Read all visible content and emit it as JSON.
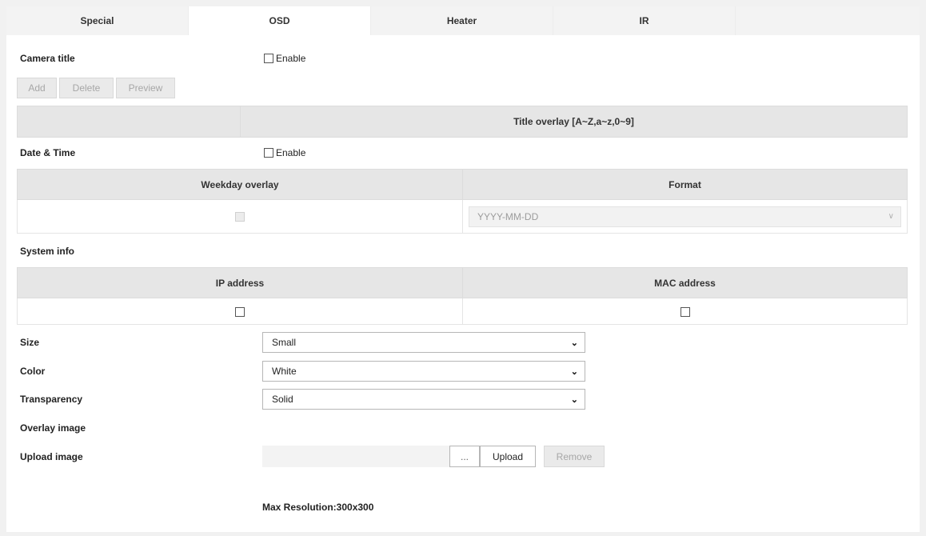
{
  "tabs": [
    {
      "label": "Special",
      "active": false
    },
    {
      "label": "OSD",
      "active": true
    },
    {
      "label": "Heater",
      "active": false
    },
    {
      "label": "IR",
      "active": false
    }
  ],
  "camera_title": {
    "label": "Camera title",
    "enable_label": "Enable",
    "buttons": {
      "add": "Add",
      "delete": "Delete",
      "preview": "Preview"
    },
    "table_header": "Title overlay [A~Z,a~z,0~9]"
  },
  "date_time": {
    "label": "Date & Time",
    "enable_label": "Enable",
    "col_weekday": "Weekday overlay",
    "col_format": "Format",
    "format_value": "YYYY-MM-DD"
  },
  "system_info": {
    "label": "System info",
    "col_ip": "IP address",
    "col_mac": "MAC address"
  },
  "size": {
    "label": "Size",
    "value": "Small"
  },
  "color": {
    "label": "Color",
    "value": "White"
  },
  "transparency": {
    "label": "Transparency",
    "value": "Solid"
  },
  "overlay_image": {
    "label": "Overlay image"
  },
  "upload_image": {
    "label": "Upload image",
    "browse_label": "...",
    "upload_label": "Upload",
    "remove_label": "Remove"
  },
  "max_resolution": "Max Resolution:300x300"
}
